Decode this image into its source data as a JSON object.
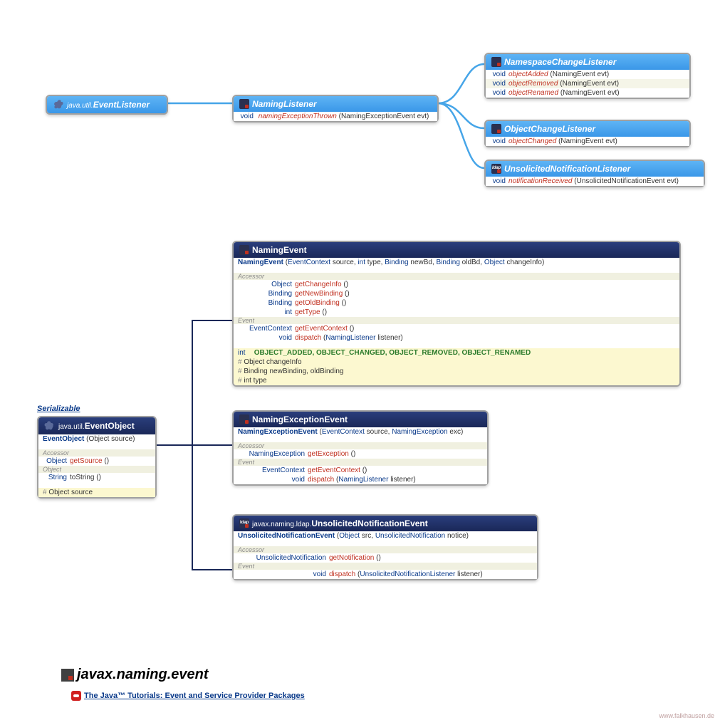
{
  "eventListener": {
    "pkg": "java.util.",
    "name": "EventListener"
  },
  "namingListener": {
    "name": "NamingListener",
    "m1_ret": "void",
    "m1": "namingExceptionThrown",
    "m1_par": "(NamingExceptionEvent evt)"
  },
  "nscl": {
    "name": "NamespaceChangeListener",
    "r": [
      {
        "ret": "void",
        "m": "objectAdded",
        "p": "(NamingEvent evt)"
      },
      {
        "ret": "void",
        "m": "objectRemoved",
        "p": "(NamingEvent evt)"
      },
      {
        "ret": "void",
        "m": "objectRenamed",
        "p": "(NamingEvent evt)"
      }
    ]
  },
  "ocl": {
    "name": "ObjectChangeListener",
    "r": {
      "ret": "void",
      "m": "objectChanged",
      "p": "(NamingEvent evt)"
    }
  },
  "unl": {
    "name": "UnsolicitedNotificationListener",
    "r": {
      "ret": "void",
      "m": "notificationReceived",
      "p": "(UnsolicitedNotificationEvent evt)"
    }
  },
  "serial": "Serializable",
  "evobj": {
    "pkg": "java.util.",
    "name": "EventObject",
    "ctor": "EventObject",
    "ctor_p": "(Object source)",
    "sec1": "Accessor",
    "r1_ret": "Object",
    "r1_m": "getSource",
    "r1_p": "()",
    "sec2": "Object",
    "r2_ret": "String",
    "r2_m": "toString",
    "r2_p": "()",
    "f": "Object source"
  },
  "nev": {
    "name": "NamingEvent",
    "ctor": "NamingEvent",
    "ctor_p": "(EventContext source, int type, Binding newBd, Binding oldBd, Object changeInfo)",
    "sec1": "Accessor",
    "a": [
      {
        "ret": "Object",
        "m": "getChangeInfo",
        "p": "()"
      },
      {
        "ret": "Binding",
        "m": "getNewBinding",
        "p": "()"
      },
      {
        "ret": "Binding",
        "m": "getOldBinding",
        "p": "()"
      },
      {
        "ret": "int",
        "m": "getType",
        "p": "()"
      }
    ],
    "sec2": "Event",
    "e": [
      {
        "ret": "EventContext",
        "m": "getEventContext",
        "p": "()"
      },
      {
        "ret": "void",
        "m": "dispatch",
        "p": "(NamingListener listener)"
      }
    ],
    "consts": "OBJECT_ADDED, OBJECT_CHANGED, OBJECT_REMOVED, OBJECT_RENAMED",
    "consts_ret": "int",
    "f": [
      "Object changeInfo",
      "Binding newBinding, oldBinding",
      "int type"
    ]
  },
  "nee": {
    "name": "NamingExceptionEvent",
    "ctor": "NamingExceptionEvent",
    "ctor_p": "(EventContext source, NamingException exc)",
    "sec1": "Accessor",
    "a": {
      "ret": "NamingException",
      "m": "getException",
      "p": "()"
    },
    "sec2": "Event",
    "e": [
      {
        "ret": "EventContext",
        "m": "getEventContext",
        "p": "()"
      },
      {
        "ret": "void",
        "m": "dispatch",
        "p": "(NamingListener listener)"
      }
    ]
  },
  "une": {
    "pkg": "javax.naming.ldap.",
    "name": "UnsolicitedNotificationEvent",
    "ctor": "UnsolicitedNotificationEvent",
    "ctor_p": "(Object src, UnsolicitedNotification notice)",
    "sec1": "Accessor",
    "a": {
      "ret": "UnsolicitedNotification",
      "m": "getNotification",
      "p": "()"
    },
    "sec2": "Event",
    "e": {
      "ret": "void",
      "m": "dispatch",
      "p": "(UnsolicitedNotificationListener listener)"
    }
  },
  "footer": {
    "title": "javax.naming.event",
    "link": "The Java™ Tutorials: Event and Service Provider Packages"
  },
  "credit": "www.falkhausen.de"
}
